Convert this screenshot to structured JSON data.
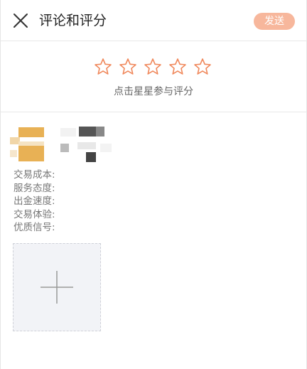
{
  "header": {
    "close_icon": "close-icon",
    "title": "评论和评分",
    "send_label": "发送"
  },
  "rating": {
    "star_count": 5,
    "rating_value": 0,
    "star_icon": "star-outline-icon",
    "star_color": "#f0875a",
    "hint": "点击星星参与评分"
  },
  "criteria": [
    "交易成本:",
    "服务态度:",
    "出金速度:",
    "交易体验:",
    "优质信号:"
  ],
  "upload": {
    "icon": "plus-icon"
  },
  "colors": {
    "accent": "#f7b79c",
    "avatar": "#e8b155",
    "divider": "#e8e8e8",
    "upload_bg": "#f2f3f7"
  }
}
